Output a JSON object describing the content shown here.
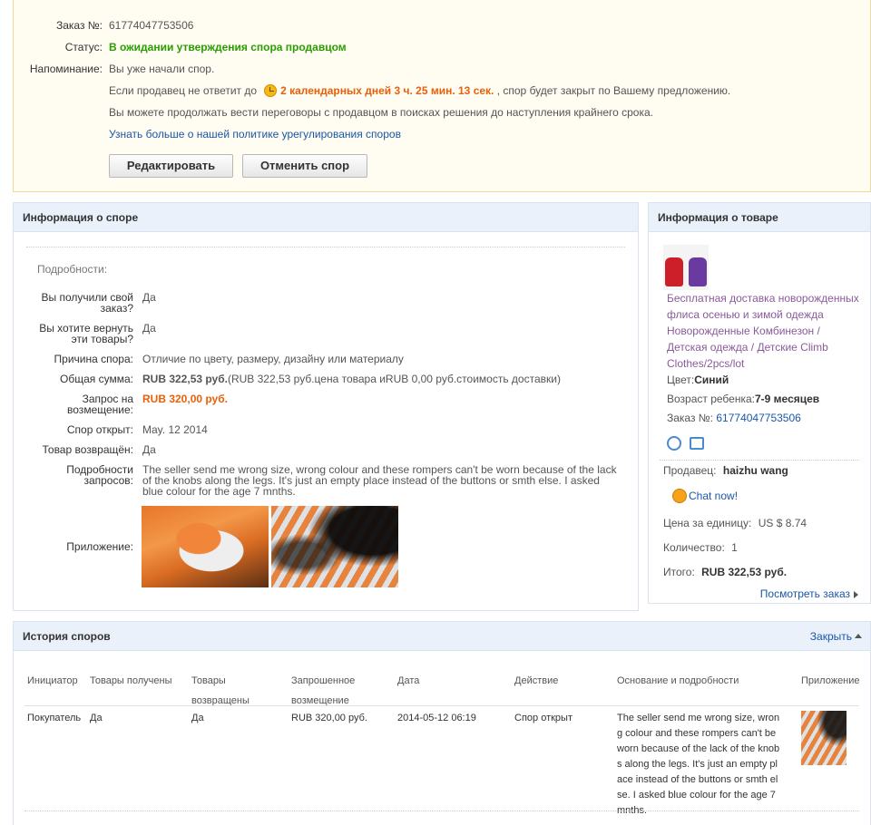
{
  "order": {
    "number_label": "Заказ №:",
    "number_value": "61774047753506",
    "status_label": "Статус:",
    "status_value": "В ожидании утверждения спора продавцом",
    "reminder_label": "Напоминание:",
    "reminder_text": "Вы уже начали спор.",
    "deadline_prefix": "Если продавец не ответит до",
    "deadline_countdown": "2 календарных дней 3 ч. 25 мин. 13 сек.",
    "deadline_suffix": ", спор будет закрыт по Вашему предложению.",
    "negotiate_text": "Вы можете продолжать вести переговоры с продавцом в поисках решения до наступления крайнего срока.",
    "policy_link": "Узнать больше о нашей политике урегулирования споров",
    "edit_button": "Редактировать",
    "cancel_button": "Отменить спор"
  },
  "dispute": {
    "title": "Информация о споре",
    "details_heading": "Подробности:",
    "received_label_1": "Вы получили свой",
    "received_label_2": "заказ?",
    "received_value": "Да",
    "return_label_1": "Вы хотите вернуть",
    "return_label_2": "эти товары?",
    "return_value": "Да",
    "reason_label": "Причина спора:",
    "reason_value": "Отличие по цвету, размеру, дизайну или материалу",
    "total_label": "Общая сумма:",
    "total_value_bold": "RUB 322,53 руб.",
    "total_value_detail": "(RUB 322,53 руб.цена товара иRUB 0,00 руб.стоимость доставки)",
    "refund_label_1": "Запрос на",
    "refund_label_2": "возмещение:",
    "refund_value": "RUB 320,00 руб.",
    "opened_label": "Спор открыт:",
    "opened_value": "May. 12 2014",
    "returned_label": "Товар возвращён:",
    "returned_value": "Да",
    "request_label_1": "Подробности",
    "request_label_2": "запросов:",
    "request_line_1": "The seller send me wrong size, wrong colour and these rompers can't be worn because of the lack",
    "request_line_2": "of the knobs along the legs. It's just an empty place instead of the buttons or smth else. I asked",
    "request_line_3": "blue colour for the age 7 mnths.",
    "attachment_label": "Приложение:"
  },
  "product": {
    "title": "Информация о товаре",
    "name_1": "Бесплатная доставка новорожденных",
    "name_2": "флиса осенью и зимой одежда",
    "name_3": "Новорожденные Комбинезон /",
    "name_4": "Детская одежда / Детские Climb",
    "name_5": "Clothes/2pcs/lot",
    "color_label": "Цвет:",
    "color_value": "Синий",
    "age_label": "Возраст ребенка:",
    "age_value": "7-9 месяцев",
    "order_label": "Заказ №:",
    "order_value": "61774047753506",
    "seller_label": "Продавец:",
    "seller_value": "haizhu wang",
    "chat_label": "Chat now!",
    "unit_price_label": "Цена за единицу:",
    "unit_price_value": "US $ 8.74",
    "quantity_label": "Количество:",
    "quantity_value": "1",
    "total_label": "Итого:",
    "total_value": "RUB 322,53 руб.",
    "view_order_link": "Посмотреть заказ"
  },
  "history": {
    "title": "История споров",
    "close_link": "Закрыть",
    "columns": {
      "initiator": "Инициатор",
      "received": "Товары получены",
      "returned_1": "Товары",
      "returned_2": "возвращены",
      "requested_1": "Запрошенное",
      "requested_2": "возмещение",
      "date": "Дата",
      "action": "Действие",
      "reason": "Основание и подробности",
      "attachment": "Приложение"
    },
    "row": {
      "initiator": "Покупатель",
      "received": "Да",
      "returned": "Да",
      "requested": "RUB 320,00 руб.",
      "date": "2014-05-12 06:19",
      "action": "Спор открыт",
      "reason_1": "The seller send me wrong size, wron",
      "reason_2": "g colour and these rompers can't be",
      "reason_3": "worn because of the lack of the knob",
      "reason_4": "s along the legs. It's just an empty pl",
      "reason_5": "ace instead of the buttons or smth el",
      "reason_6": "se. I asked blue colour for the age 7",
      "reason_7": "mnths."
    }
  },
  "colors": {
    "status_green": "#2a9d00",
    "countdown_orange": "#e8600a",
    "link_blue": "#1a57a8",
    "panel_header": "#eaf1fa",
    "product_link_purple": "#8a5a9a"
  }
}
